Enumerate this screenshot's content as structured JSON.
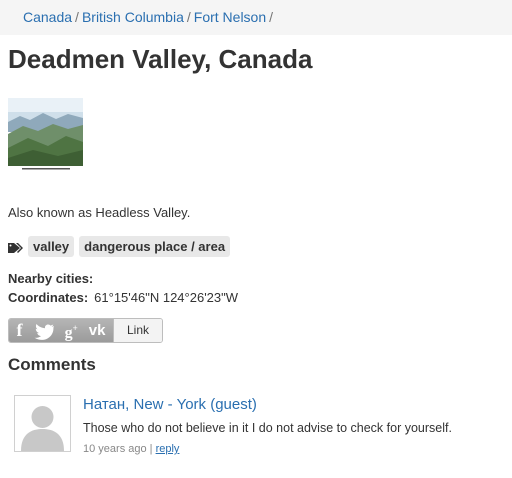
{
  "breadcrumb": {
    "items": [
      "Canada",
      "British Columbia",
      "Fort Nelson"
    ],
    "separator": "/"
  },
  "page_title": "Deadmen Valley, Canada",
  "photo": {
    "caption": "Deadmen Valley mountain scenery"
  },
  "aka_text": "Also known as Headless Valley.",
  "tags": [
    "valley",
    "dangerous place / area"
  ],
  "nearby": {
    "label": "Nearby cities:"
  },
  "coordinates": {
    "label": "Coordinates:",
    "value": "61°15'46\"N 124°26'23\"W"
  },
  "share": {
    "icons": [
      "facebook-icon",
      "twitter-icon",
      "google-plus-icon",
      "vk-icon"
    ],
    "link_label": "Link"
  },
  "comments": {
    "heading": "Comments",
    "items": [
      {
        "author": "Натан, New - York (guest)",
        "text": "Those who do not believe in it I do not advise to check for yourself.",
        "time": "10 years ago",
        "reply_label": "reply"
      }
    ]
  },
  "colors": {
    "link": "#2a6fb0",
    "breadcrumb_bg": "#f5f5f5",
    "tag_bg": "#e8e8e8"
  }
}
